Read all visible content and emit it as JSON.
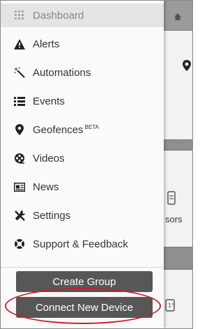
{
  "drawer": {
    "items": [
      {
        "label": "Dashboard",
        "icon": "grid-icon",
        "active": true
      },
      {
        "label": "Alerts",
        "icon": "warning-icon"
      },
      {
        "label": "Automations",
        "icon": "magic-wand-icon"
      },
      {
        "label": "Events",
        "icon": "list-icon"
      },
      {
        "label": "Geofences",
        "badge": "BETA",
        "icon": "location-pin-icon"
      },
      {
        "label": "Videos",
        "icon": "film-reel-icon"
      },
      {
        "label": "News",
        "icon": "newspaper-icon"
      },
      {
        "label": "Settings",
        "icon": "wrench-screwdriver-icon"
      },
      {
        "label": "Support & Feedback",
        "icon": "lifebuoy-icon"
      }
    ],
    "create_group_label": "Create Group",
    "connect_device_label": "Connect New Device"
  },
  "background": {
    "sensor_label_fragment": "sors"
  },
  "colors": {
    "button": "#575757",
    "highlight": "#cc1f2f",
    "active_row": "#e4e4e4"
  }
}
